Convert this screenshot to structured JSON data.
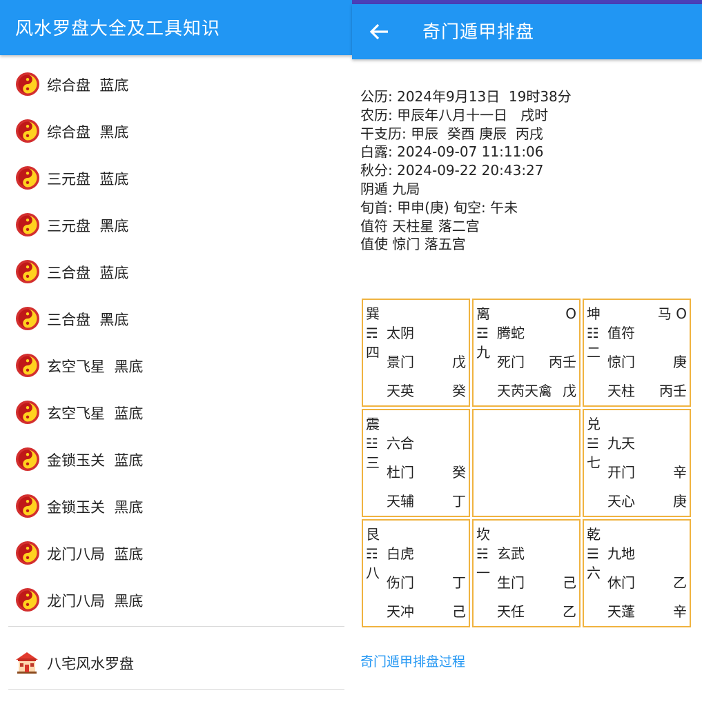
{
  "left": {
    "title": "风水罗盘大全及工具知识",
    "items": [
      {
        "label": "综合盘  蓝底"
      },
      {
        "label": "综合盘  黑底"
      },
      {
        "label": "三元盘  蓝底"
      },
      {
        "label": "三元盘  黑底"
      },
      {
        "label": "三合盘  蓝底"
      },
      {
        "label": "三合盘  黑底"
      },
      {
        "label": "玄空飞星  黑底"
      },
      {
        "label": "玄空飞星  蓝底"
      },
      {
        "label": "金锁玉关  蓝底"
      },
      {
        "label": "金锁玉关  黑底"
      },
      {
        "label": "龙门八局  蓝底"
      },
      {
        "label": "龙门八局  黑底"
      }
    ],
    "house_item": {
      "label": "八宅风水罗盘",
      "icon": "house-icon"
    },
    "item_icon": "yin-yang-icon"
  },
  "right": {
    "title": "奇门遁甲排盘",
    "back_icon": "back-arrow-icon",
    "info": [
      "公历: 2024年9月13日  19时38分",
      "农历: 甲辰年八月十一日   戌时",
      "干支历: 甲辰  癸酉 庚辰  丙戌",
      "白露: 2024-09-07 11:11:06",
      "秋分: 2024-09-22 20:43:27",
      "阴遁 九局",
      "旬首: 甲申(庚) 旬空: 午未",
      "值符 天柱星 落二宫",
      "值使 惊门 落五宫"
    ],
    "palaces": [
      {
        "name": "巽",
        "tri": "☴",
        "num": "四",
        "corner": "",
        "god": "太阴",
        "door": "景门",
        "door_stem": "戊",
        "star": "天英",
        "star_stem": "癸"
      },
      {
        "name": "离",
        "tri": "☲",
        "num": "九",
        "corner": "O",
        "god": "腾蛇",
        "door": "死门",
        "door_stem": "丙壬",
        "star": "天芮天禽",
        "star_stem": "戊"
      },
      {
        "name": "坤",
        "tri": "☷",
        "num": "二",
        "corner": "马 O",
        "god": "值符",
        "door": "惊门",
        "door_stem": "庚",
        "star": "天柱",
        "star_stem": "丙壬"
      },
      {
        "name": "震",
        "tri": "☳",
        "num": "三",
        "corner": "",
        "god": "六合",
        "door": "杜门",
        "door_stem": "癸",
        "star": "天辅",
        "star_stem": "丁"
      },
      {
        "name": "",
        "tri": "",
        "num": "",
        "corner": "",
        "god": "",
        "door": "",
        "door_stem": "",
        "star": "",
        "star_stem": ""
      },
      {
        "name": "兑",
        "tri": "☱",
        "num": "七",
        "corner": "",
        "god": "九天",
        "door": "开门",
        "door_stem": "辛",
        "star": "天心",
        "star_stem": "庚"
      },
      {
        "name": "艮",
        "tri": "☶",
        "num": "八",
        "corner": "",
        "god": "白虎",
        "door": "伤门",
        "door_stem": "丁",
        "star": "天冲",
        "star_stem": "己"
      },
      {
        "name": "坎",
        "tri": "☵",
        "num": "一",
        "corner": "",
        "god": "玄武",
        "door": "生门",
        "door_stem": "己",
        "star": "天任",
        "star_stem": "乙"
      },
      {
        "name": "乾",
        "tri": "☰",
        "num": "六",
        "corner": "",
        "god": "九地",
        "door": "休门",
        "door_stem": "乙",
        "star": "天蓬",
        "star_stem": "辛"
      }
    ],
    "process_link": "奇门遁甲排盘过程",
    "colors": {
      "appbar": "#2196F3",
      "cell_border": "#f0b340",
      "link": "#2196F3"
    }
  }
}
